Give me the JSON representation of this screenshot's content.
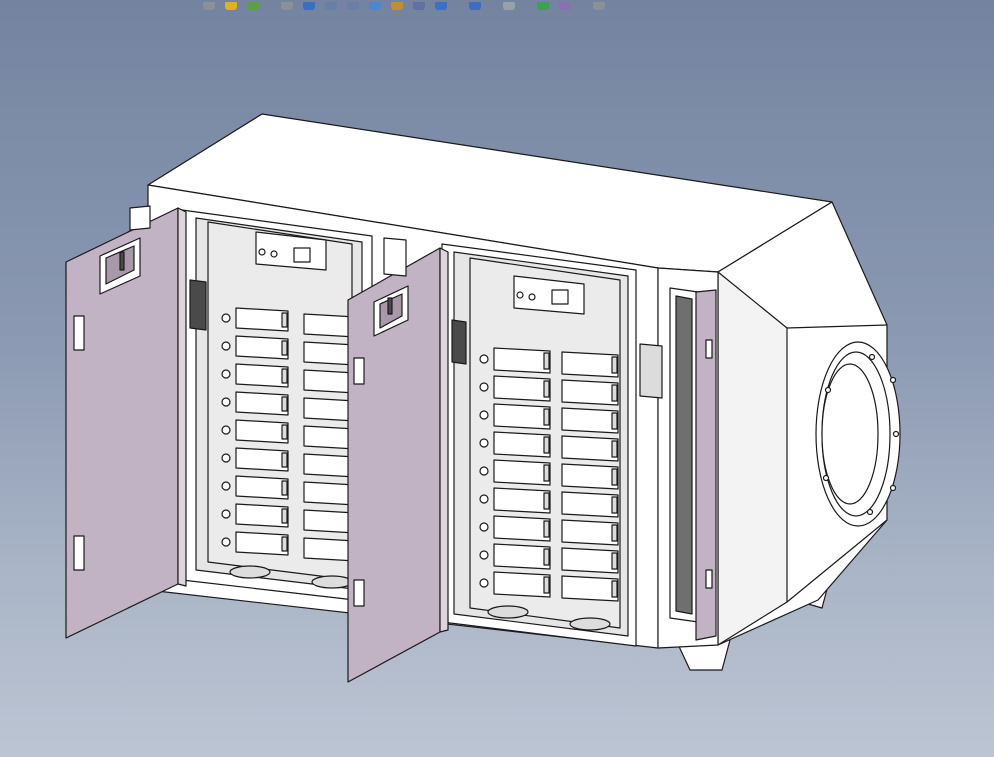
{
  "window": {
    "background_top": "#7484a0",
    "background_bottom": "#bcc5d3"
  },
  "toolbar": {
    "buttons": [
      {
        "name": "new-document-icon",
        "color": "#8a8f98"
      },
      {
        "name": "save-icon",
        "color": "#e0b020"
      },
      {
        "name": "rebuild-icon",
        "color": "#5aa040"
      },
      {
        "name": "sep",
        "color": ""
      },
      {
        "name": "select-icon",
        "color": "#8a8f98"
      },
      {
        "name": "rotate-view-icon",
        "color": "#3a6fc0"
      },
      {
        "name": "zoom-to-fit-icon",
        "color": "#6a7fa8"
      },
      {
        "name": "zoom-area-icon",
        "color": "#6a7fa8"
      },
      {
        "name": "pan-icon",
        "color": "#4a88d0"
      },
      {
        "name": "section-view-icon",
        "color": "#c09030"
      },
      {
        "name": "view-orientation-icon",
        "color": "#6070a0"
      },
      {
        "name": "display-style-icon",
        "color": "#3a70c8"
      },
      {
        "name": "sep",
        "color": ""
      },
      {
        "name": "hide-show-icon",
        "color": "#3a6fc0"
      },
      {
        "name": "sep",
        "color": ""
      },
      {
        "name": "edit-appearance-icon",
        "color": "#9aa0aa"
      },
      {
        "name": "sep",
        "color": ""
      },
      {
        "name": "scene-icon",
        "color": "#40a050"
      },
      {
        "name": "render-tools-icon",
        "color": "#8a70b0"
      },
      {
        "name": "sep",
        "color": ""
      },
      {
        "name": "view-settings-icon",
        "color": "#8a8f98"
      }
    ]
  },
  "model": {
    "name": "ozone-uv-purifier-cabinet",
    "body_color": "#ffffff",
    "door_color": "#c1b2c4",
    "interior_color": "#e6e6e6",
    "lamp_rows": 9,
    "lamp_columns": 2,
    "compartments": 2
  }
}
